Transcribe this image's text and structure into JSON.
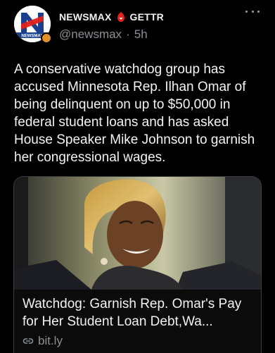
{
  "post": {
    "author": {
      "logo_text": "NEWSMAX",
      "display_name": "NEWSMAX",
      "platform_name": "GETTR",
      "handle": "@newsmax",
      "separator": "·",
      "time_ago": "5h"
    },
    "text": "A conservative watchdog group has accused Minnesota Rep. Ilhan Omar of being delinquent on up to $50,000 in federal student loans and has asked House Speaker Mike Johnson to garnish her congressional wages.",
    "link_card": {
      "title": "Watchdog: Garnish Rep. Omar's Pay for Her Student Loan Debt,Wa...",
      "domain": "bit.ly"
    }
  },
  "icons": {
    "more": "more-dots-icon",
    "platform": "gettr-icon",
    "link": "link-icon"
  },
  "colors": {
    "background": "#000000",
    "text_primary": "#f4f4f4",
    "text_secondary": "#8b8f94",
    "brand_red": "#e2231a",
    "newsmax_blue": "#1b3f8f",
    "card_border": "#3a3d41"
  }
}
